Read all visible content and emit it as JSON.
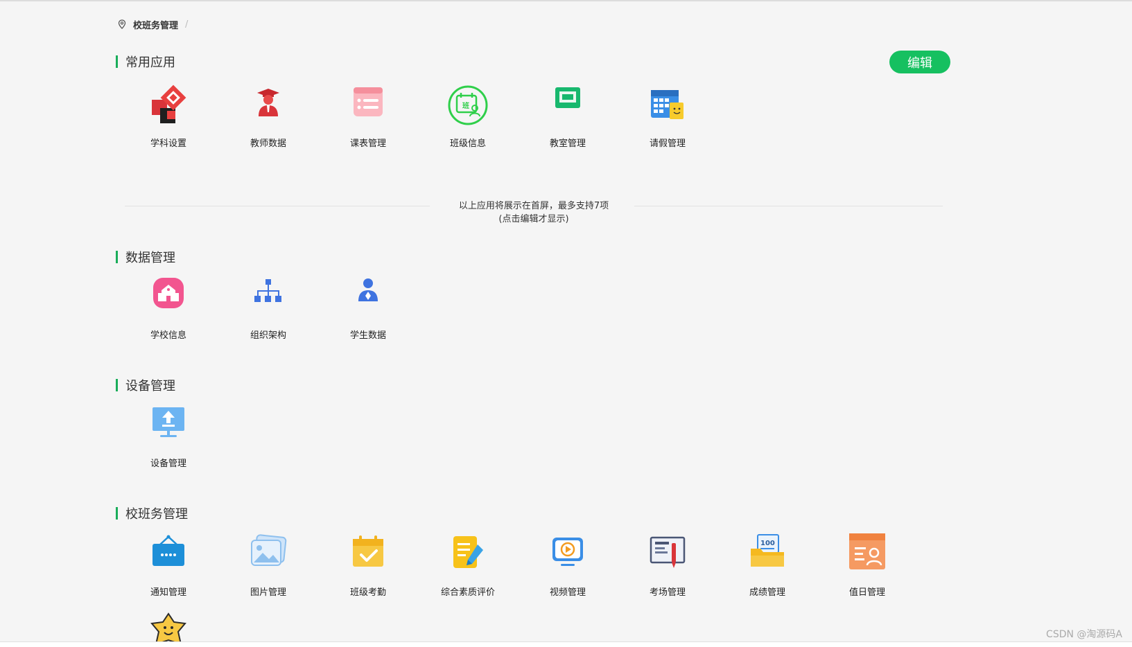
{
  "breadcrumb": {
    "icon": "location-pin-icon",
    "current": "校班务管理",
    "separator": "/"
  },
  "edit_button": {
    "label": "编辑",
    "color": "#16c060"
  },
  "accent_color": "#1aad5a",
  "sections": {
    "common": {
      "title": "常用应用",
      "apps": [
        {
          "label": "学科设置",
          "icon": "subject-settings-icon"
        },
        {
          "label": "教师数据",
          "icon": "teacher-data-icon"
        },
        {
          "label": "课表管理",
          "icon": "schedule-icon"
        },
        {
          "label": "班级信息",
          "icon": "class-info-icon"
        },
        {
          "label": "教室管理",
          "icon": "classroom-icon"
        },
        {
          "label": "请假管理",
          "icon": "leave-calendar-icon"
        }
      ]
    },
    "data": {
      "title": "数据管理",
      "apps": [
        {
          "label": "学校信息",
          "icon": "school-icon"
        },
        {
          "label": "组织架构",
          "icon": "org-chart-icon"
        },
        {
          "label": "学生数据",
          "icon": "student-icon"
        }
      ]
    },
    "device": {
      "title": "设备管理",
      "apps": [
        {
          "label": "设备管理",
          "icon": "monitor-upload-icon"
        }
      ]
    },
    "school": {
      "title": "校班务管理",
      "apps": [
        {
          "label": "通知管理",
          "icon": "notice-board-icon"
        },
        {
          "label": "图片管理",
          "icon": "image-icon"
        },
        {
          "label": "班级考勤",
          "icon": "attendance-icon"
        },
        {
          "label": "综合素质评价",
          "icon": "evaluation-icon"
        },
        {
          "label": "视频管理",
          "icon": "video-icon"
        },
        {
          "label": "考场管理",
          "icon": "exam-room-icon"
        },
        {
          "label": "成绩管理",
          "icon": "score-icon"
        },
        {
          "label": "值日管理",
          "icon": "duty-icon"
        },
        {
          "label": "",
          "icon": "smiley-star-icon"
        }
      ]
    }
  },
  "divider": {
    "line1": "以上应用将展示在首屏，最多支持7项",
    "line2": "(点击编辑才显示)"
  },
  "watermark": "CSDN @淘源码A"
}
